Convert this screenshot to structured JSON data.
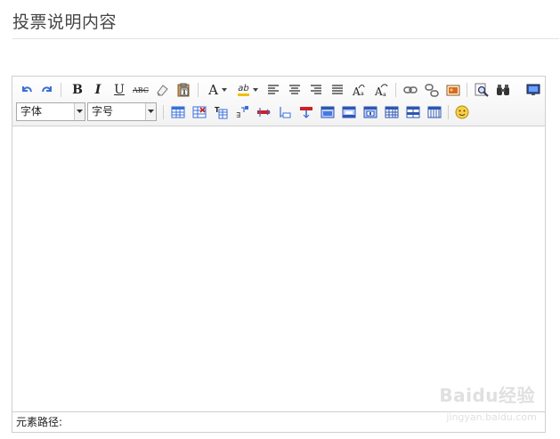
{
  "header": {
    "title": "投票说明内容"
  },
  "toolbar": {
    "font_family": {
      "selected": "字体"
    },
    "font_size": {
      "selected": "字号"
    },
    "glyphs": {
      "bold": "B",
      "italic": "I",
      "underline": "U",
      "strike": "ABC",
      "font_color": "A",
      "highlight": "ab"
    },
    "icons": [
      "undo-icon",
      "redo-icon",
      "bold-icon",
      "italic-icon",
      "underline-icon",
      "strikethrough-icon",
      "eraser-icon",
      "paste-text-icon",
      "font-color-icon",
      "highlight-color-icon",
      "align-left-icon",
      "align-center-icon",
      "align-right-icon",
      "align-justify-icon",
      "superscript-icon",
      "subscript-icon",
      "link-icon",
      "unlink-icon",
      "insert-image-icon",
      "preview-icon",
      "find-replace-icon",
      "source-code-icon",
      "insert-table-icon",
      "delete-table-icon",
      "insert-row-before-icon",
      "insert-row-after-icon",
      "delete-row-icon",
      "insert-col-before-icon",
      "insert-col-after-icon",
      "delete-col-icon",
      "merge-cells-icon",
      "merge-right-icon",
      "merge-down-icon",
      "split-cells-icon",
      "split-rows-icon",
      "split-cols-icon",
      "emoticon-icon"
    ]
  },
  "status_bar": {
    "element_path_label": "元素路径:"
  },
  "watermark": {
    "brand": "Baidu经验",
    "url": "jingyan.baidu.com"
  },
  "colors": {
    "accent_blue": "#3a6fd8",
    "icon_red": "#cc2222",
    "border": "#cfcfcf"
  }
}
